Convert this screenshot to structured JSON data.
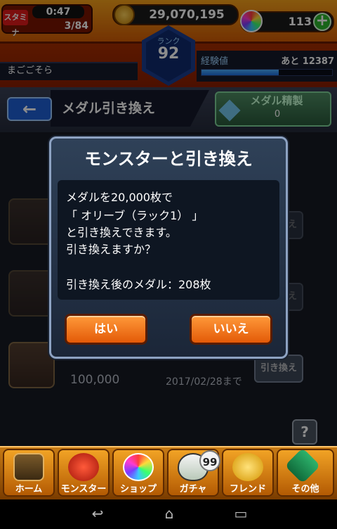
{
  "status": {
    "stamina_label": "スタミナ",
    "stamina_time": "0:47",
    "stamina_count": "3/84",
    "gold": "29,070,195",
    "orbs": "113",
    "orbs_add": "+",
    "player_name": "まごごそら",
    "rank_label": "ランク",
    "rank": "92",
    "exp_label": "経験値",
    "exp_remaining": "あと 12387",
    "exp_fraction": 0.59
  },
  "header": {
    "back_icon": "←",
    "title": "メダル引き換え",
    "craft_label": "メダル精製",
    "craft_count": "0"
  },
  "background_list": {
    "row_button": "引き換え",
    "price": "100,000",
    "date": "2017/02/28まで",
    "help": "?"
  },
  "dialog": {
    "title": "モンスターと引き換え",
    "lines": [
      "メダルを20,000枚で",
      "「 オリーブ（ラック1） 」",
      "と引き換えできます。",
      "引き換えますか？",
      "",
      "引き換え後のメダル：208枚"
    ],
    "yes": "はい",
    "no": "いいえ"
  },
  "nav": {
    "items": [
      "ホーム",
      "モンスター",
      "ショップ",
      "ガチャ",
      "フレンド",
      "その他"
    ],
    "gacha_badge": "99"
  },
  "system_nav": {
    "back": "↩",
    "home": "⌂",
    "recent": "▭"
  },
  "colors": {
    "accent_orange": "#e35a08",
    "panel_blue": "#1e60d6",
    "exp_blue": "#1e6fe0"
  }
}
